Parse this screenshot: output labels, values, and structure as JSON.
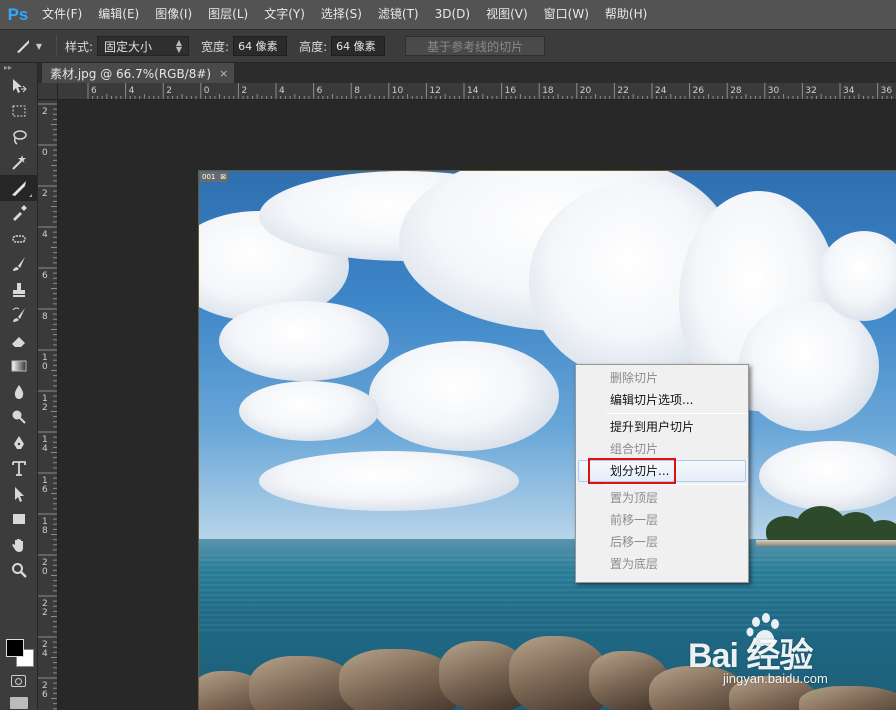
{
  "app": {
    "logo": "Ps",
    "menu": [
      "文件(F)",
      "编辑(E)",
      "图像(I)",
      "图层(L)",
      "文字(Y)",
      "选择(S)",
      "滤镜(T)",
      "3D(D)",
      "视图(V)",
      "窗口(W)",
      "帮助(H)"
    ]
  },
  "options": {
    "style_label": "样式:",
    "style_value": "固定大小",
    "width_label": "宽度:",
    "width_value": "64 像素",
    "height_label": "高度:",
    "height_value": "64 像素",
    "guides_button": "基于参考线的切片"
  },
  "document": {
    "tab_title": "素材.jpg @ 66.7%(RGB/8#)",
    "close_glyph": "×",
    "slice_badge": [
      "001",
      "⊠"
    ]
  },
  "rulers": {
    "h_labels": [
      "6",
      "4",
      "2",
      "0",
      "2",
      "4",
      "6",
      "8",
      "10",
      "12",
      "14",
      "16",
      "18",
      "20",
      "22",
      "24",
      "26",
      "28",
      "30",
      "32",
      "34",
      "36"
    ],
    "v_labels": [
      "2",
      "0",
      "2",
      "4",
      "6",
      "8",
      "1 0",
      "1 2",
      "1 4",
      "1 6",
      "1 8",
      "2 0",
      "2 2",
      "2 4",
      "2 6"
    ]
  },
  "toolbar": {
    "tools": [
      "move-tool",
      "marquee-tool",
      "lasso-tool",
      "magic-wand-tool",
      "slice-tool",
      "eyedropper-tool",
      "healing-brush-tool",
      "brush-tool",
      "stamp-tool",
      "history-brush-tool",
      "eraser-tool",
      "gradient-tool",
      "blur-tool",
      "dodge-tool",
      "pen-tool",
      "type-tool",
      "path-selection-tool",
      "rectangle-tool",
      "hand-tool",
      "zoom-tool"
    ],
    "active_tool": "slice-tool",
    "foreground_color": "#000000",
    "background_color": "#ffffff"
  },
  "context_menu": {
    "items": [
      {
        "label": "删除切片",
        "disabled": true
      },
      {
        "label": "编辑切片选项...",
        "disabled": false
      },
      {
        "separator": true
      },
      {
        "label": "提升到用户切片",
        "disabled": false
      },
      {
        "label": "组合切片",
        "disabled": true
      },
      {
        "label": "划分切片...",
        "disabled": false,
        "hover": true
      },
      {
        "separator": true
      },
      {
        "label": "置为顶层",
        "disabled": true
      },
      {
        "label": "前移一层",
        "disabled": true
      },
      {
        "label": "后移一层",
        "disabled": true
      },
      {
        "label": "置为底层",
        "disabled": true
      }
    ]
  },
  "watermark": {
    "main": "Bai 经验",
    "sub": "jingyan.baidu.com"
  },
  "colors": {
    "ps_blue": "#31a8ff",
    "highlight_red": "#e01010"
  }
}
